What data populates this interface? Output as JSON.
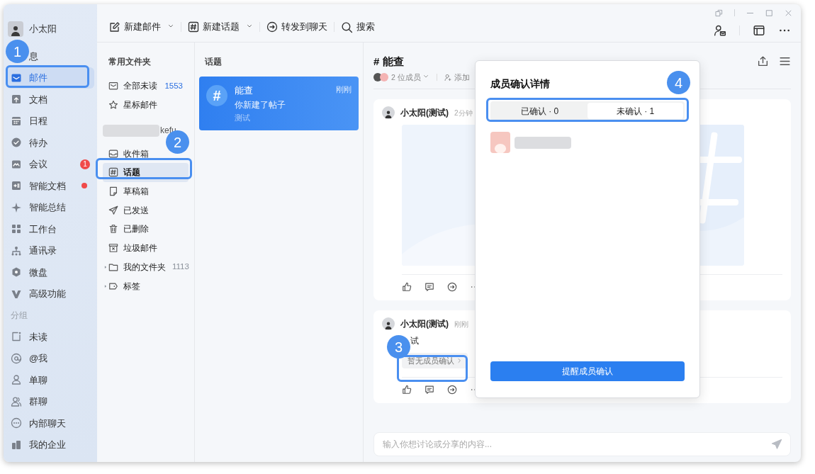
{
  "user": {
    "name": "小太阳"
  },
  "nav": {
    "items": [
      {
        "label": "息",
        "selected": false
      },
      {
        "label": "邮件",
        "selected": true
      },
      {
        "label": "文档",
        "selected": false
      },
      {
        "label": "日程",
        "selected": false
      },
      {
        "label": "待办",
        "selected": false
      },
      {
        "label": "会议",
        "selected": false,
        "badge": "1"
      },
      {
        "label": "智能文档",
        "selected": false,
        "dot": true
      },
      {
        "label": "智能总结",
        "selected": false
      },
      {
        "label": "工作台",
        "selected": false
      },
      {
        "label": "通讯录",
        "selected": false
      },
      {
        "label": "微盘",
        "selected": false
      },
      {
        "label": "高级功能",
        "selected": false
      }
    ],
    "group_title": "分组",
    "group_items": [
      {
        "label": "未读"
      },
      {
        "label": "@我"
      },
      {
        "label": "单聊"
      },
      {
        "label": "群聊"
      },
      {
        "label": "内部聊天"
      }
    ],
    "footer_item": {
      "label": "我的企业"
    }
  },
  "toolbar": {
    "actions": [
      {
        "label": "新建邮件",
        "dropdown": true
      },
      {
        "label": "新建话题",
        "dropdown": true
      },
      {
        "label": "转发到聊天",
        "dropdown": false
      },
      {
        "label": "搜索",
        "dropdown": false
      }
    ]
  },
  "folders": {
    "title": "常用文件夹",
    "favorites": [
      {
        "label": "全部未读",
        "count": "1553",
        "selected": false
      },
      {
        "label": "星标邮件",
        "selected": false
      }
    ],
    "account": {
      "label": "kefu"
    },
    "items": [
      {
        "label": "收件箱",
        "selected": false,
        "expandable": false
      },
      {
        "label": "话题",
        "selected": true,
        "expandable": false
      },
      {
        "label": "草稿箱",
        "selected": false,
        "expandable": false
      },
      {
        "label": "已发送",
        "selected": false,
        "expandable": false
      },
      {
        "label": "已删除",
        "selected": false,
        "expandable": false
      },
      {
        "label": "垃圾邮件",
        "selected": false,
        "expandable": false
      },
      {
        "label": "我的文件夹",
        "count": "1113",
        "selected": false,
        "expandable": true
      },
      {
        "label": "标签",
        "selected": false,
        "expandable": true
      }
    ]
  },
  "topics": {
    "title": "话题",
    "items": [
      {
        "icon": "#",
        "title": "能查",
        "time": "刚刚",
        "summary": "你新建了帖子",
        "tag": "测试",
        "selected": true
      }
    ]
  },
  "thread": {
    "title": "# 能查",
    "member_count": "2 位成员",
    "add_member": "添加",
    "posts": [
      {
        "kind": "image",
        "author": "小太阳(测试)",
        "time": "2分钟"
      },
      {
        "kind": "text",
        "author": "小太阳(测试)",
        "time": "刚刚",
        "body": "试",
        "confirm_button": "暂无成员确认"
      }
    ],
    "composer": {
      "placeholder": "输入你想讨论或分享的内容..."
    }
  },
  "popup": {
    "title": "成员确认详情",
    "tabs": [
      {
        "label": "已确认 · 0",
        "selected": false
      },
      {
        "label": "未确认 · 1",
        "selected": true
      }
    ],
    "members": [
      {
        "kind": "redacted"
      }
    ],
    "button": "提醒成员确认"
  },
  "callouts": [
    {
      "number": "1"
    },
    {
      "number": "2"
    },
    {
      "number": "3"
    },
    {
      "number": "4"
    }
  ]
}
